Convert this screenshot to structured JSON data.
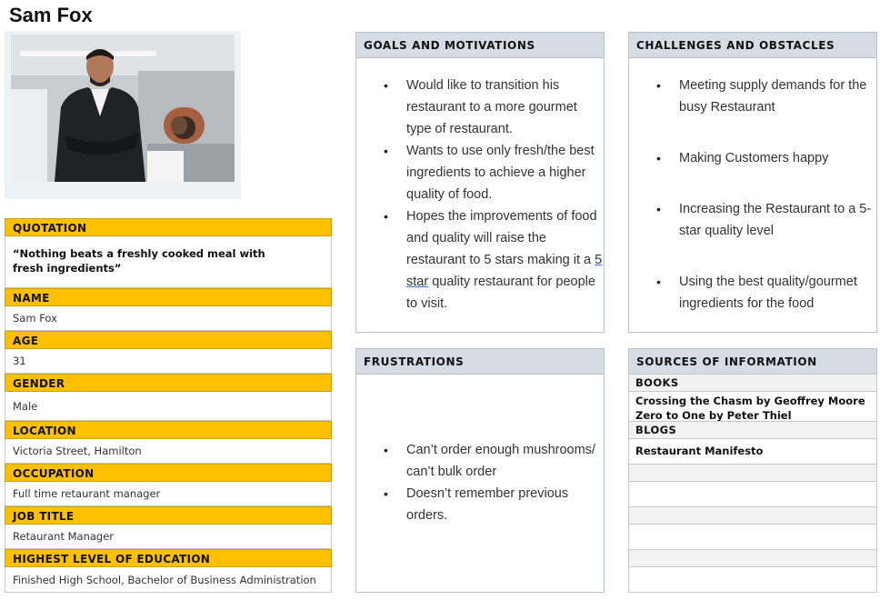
{
  "persona": {
    "name": "Sam Fox"
  },
  "left_table": {
    "quotation_label": "QUOTATION",
    "quotation": "“Nothing beats a freshly cooked meal with fresh ingredients”",
    "name_label": "NAME",
    "name": "Sam Fox",
    "age_label": "AGE",
    "age": "31",
    "gender_label": "GENDER",
    "gender": "Male",
    "location_label": "LOCATION",
    "location": "Victoria Street, Hamilton",
    "occupation_label": "OCCUPATION",
    "occupation": "Full time retaurant manager",
    "job_title_label": "JOB TITLE",
    "job_title": "Retaurant Manager",
    "education_label": "HIGHEST LEVEL OF EDUCATION",
    "education": "Finished High School, Bachelor of Business Administration"
  },
  "goals": {
    "title": "GOALS AND MOTIVATIONS",
    "items": [
      "Would like to transition his restaurant to a more gourmet type of restaurant.",
      "Wants to use only fresh/the best ingredients to achieve a higher quality of food.",
      {
        "before": "Hopes the improvements of food and quality will raise the restaurant to 5 stars making it a ",
        "underlined": "5 star",
        "after": " quality restaurant for people to visit."
      }
    ]
  },
  "challenges": {
    "title": "CHALLENGES AND OBSTACLES",
    "items": [
      "Meeting supply demands for the busy Restaurant",
      "Making Customers happy",
      "Increasing the Restaurant to a 5-star quality level",
      "Using the best quality/gourmet ingredients for the food"
    ]
  },
  "frustrations": {
    "title": "FRUSTRATIONS",
    "items": [
      "Can’t order enough mushrooms/ can’t bulk order",
      "Doesn’t remember previous orders."
    ]
  },
  "sources": {
    "title": "SOURCES OF INFORMATION",
    "books_label": "BOOKS",
    "books": [
      "Crossing the Chasm by Geoffrey Moore",
      "Zero to One by Peter Thiel"
    ],
    "blogs_label": "BLOGS",
    "blogs": [
      "Restaurant Manifesto"
    ]
  },
  "colors": {
    "label_bg": "#ffc000",
    "panel_header_bg": "#d5dce4",
    "border": "#b9c0c8"
  }
}
